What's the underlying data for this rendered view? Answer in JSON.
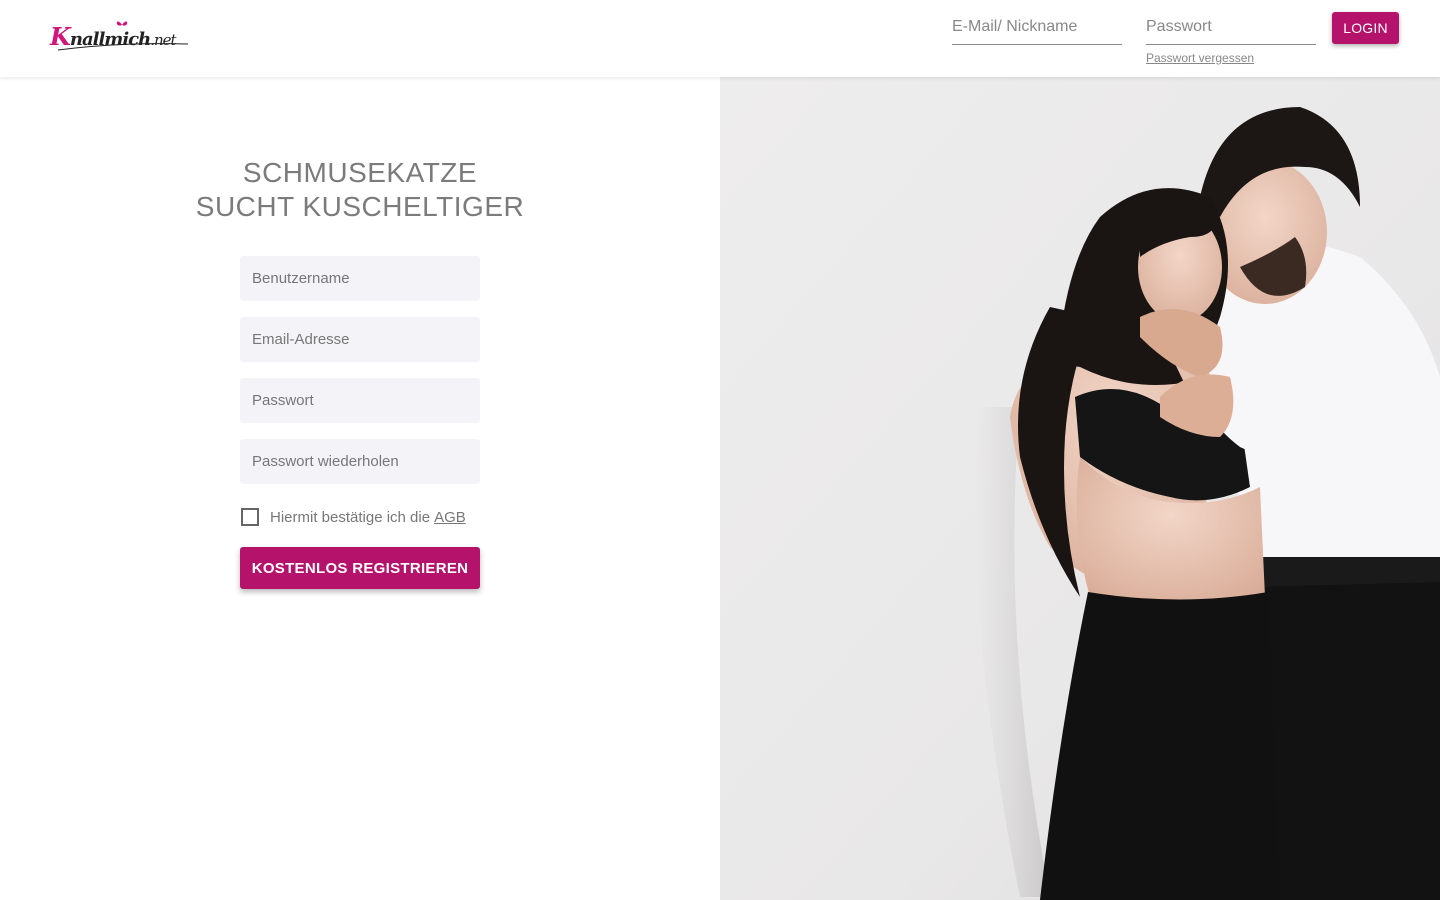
{
  "header": {
    "logo": {
      "first_letter": "K",
      "rest": "nallmich",
      "tld": ".net"
    },
    "login": {
      "email_placeholder": "E-Mail/ Nickname",
      "password_placeholder": "Passwort",
      "forgot_label": "Passwort vergessen",
      "button_label": "LOGIN"
    }
  },
  "main": {
    "headline_line1": "SCHMUSEKATZE",
    "headline_line2": "SUCHT KUSCHELTIGER",
    "form": {
      "username_placeholder": "Benutzername",
      "email_placeholder": "Email-Adresse",
      "password_placeholder": "Passwort",
      "password_repeat_placeholder": "Passwort wiederholen",
      "agb_text": "Hiermit bestätige ich die",
      "agb_link": "AGB",
      "agb_checked": false,
      "submit_label": "KOSTENLOS REGISTRIEREN"
    }
  },
  "colors": {
    "brand": "#b5136b",
    "logo_pink": "#d1157a",
    "field_bg": "#f4f4f8",
    "text_gray": "#7b7b7b"
  },
  "icons": {
    "logo_ornament": "butterfly-icon",
    "checkbox": "checkbox-unchecked-icon"
  }
}
